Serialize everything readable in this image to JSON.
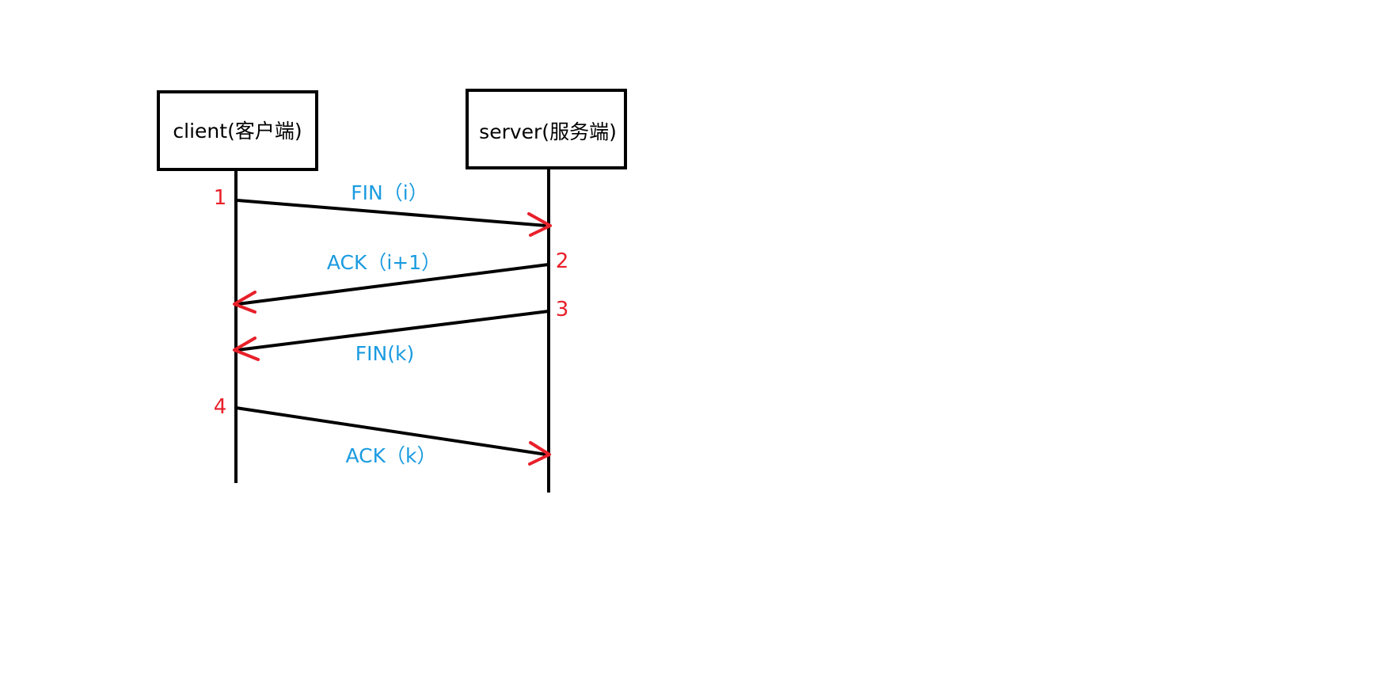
{
  "colors": {
    "line": "#000000",
    "arrowhead": "#e8202a",
    "message_text": "#1a9be0",
    "step_text": "#e8202a"
  },
  "participants": {
    "client": "client(客户端)",
    "server": "server(服务端)"
  },
  "messages": [
    {
      "step": "1",
      "label": "FIN（i）",
      "direction": "client-to-server"
    },
    {
      "step": "2",
      "label": "ACK（i+1）",
      "direction": "server-to-client"
    },
    {
      "step": "3",
      "label": "FIN(k)",
      "direction": "server-to-client"
    },
    {
      "step": "4",
      "label": "ACK（k）",
      "direction": "client-to-server"
    }
  ]
}
